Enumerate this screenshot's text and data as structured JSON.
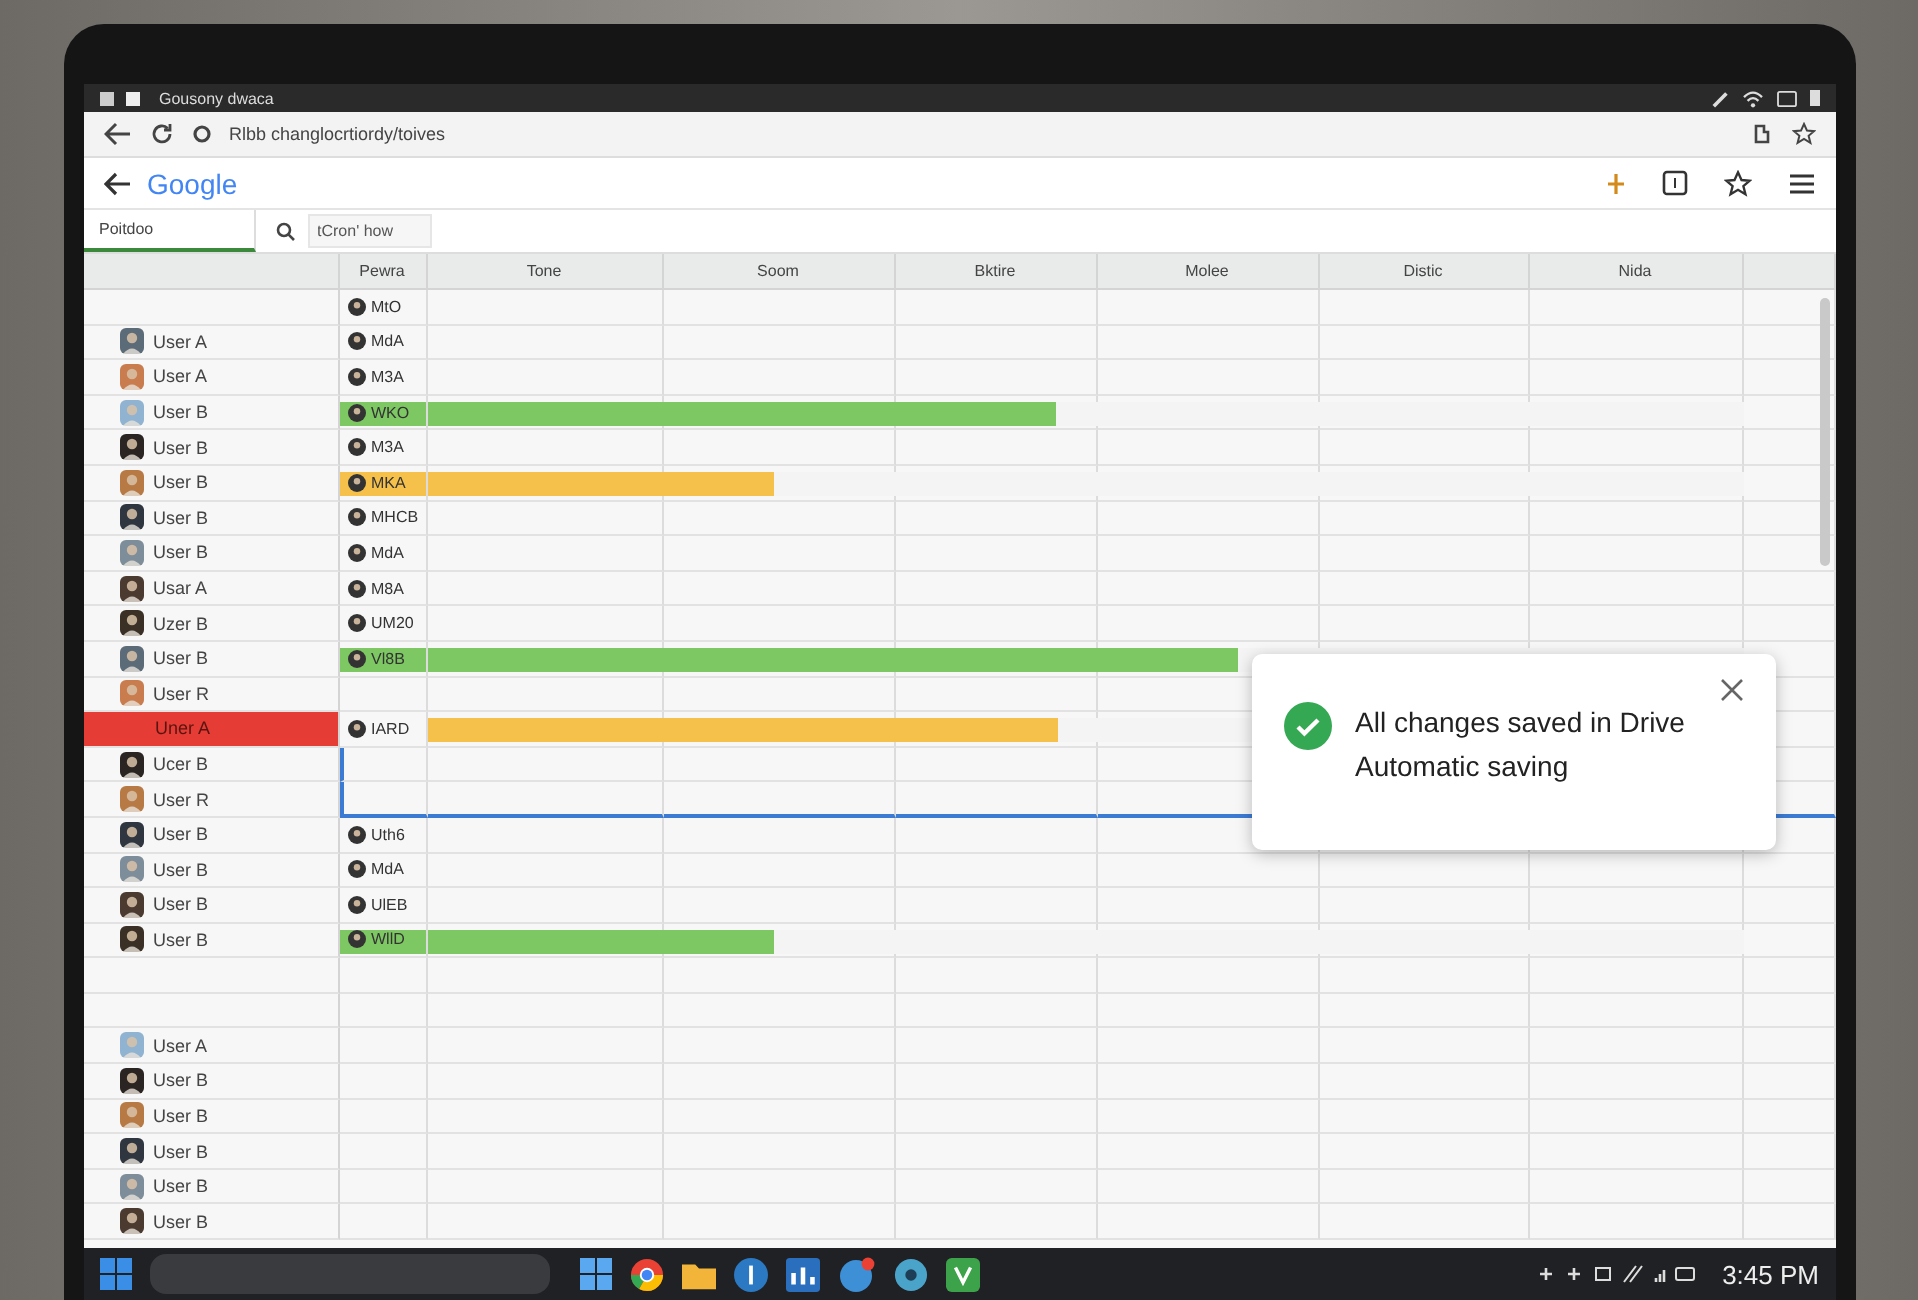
{
  "os_bar": {
    "title": "Gousony dwaca"
  },
  "address_bar": {
    "url": "Rlbb changlocrtiordy/toives"
  },
  "app_header": {
    "logo": "Google"
  },
  "toolbar": {
    "tab": {
      "label": "Poitdoo",
      "selected": true
    },
    "search": {
      "value": "tCron' how"
    }
  },
  "table": {
    "columns": [
      "Pewra",
      "Tone",
      "Soom",
      "Bktire",
      "Molee",
      "Distic",
      "Nida"
    ],
    "rows": [
      {
        "name": "",
        "chip": "MtO",
        "selected": false,
        "highlight": false
      },
      {
        "name": "User A",
        "chip": "MdA",
        "selected": false,
        "highlight": false
      },
      {
        "name": "User A",
        "chip": "M3A",
        "selected": false,
        "highlight": false
      },
      {
        "name": "User B",
        "chip": "WKO",
        "selected": false,
        "highlight": false,
        "bar": {
          "kind": "full",
          "color": "#7dc863",
          "level": 0.51
        }
      },
      {
        "name": "User B",
        "chip": "M3A",
        "selected": false,
        "highlight": false
      },
      {
        "name": "User B",
        "chip": "MKA",
        "selected": false,
        "highlight": false,
        "bar": {
          "kind": "full",
          "color": "#f5c14b",
          "level": 0.31
        }
      },
      {
        "name": "User B",
        "chip": "MHCB",
        "selected": false,
        "highlight": false
      },
      {
        "name": "User B",
        "chip": "MdA",
        "selected": false,
        "highlight": false
      },
      {
        "name": "Usar A",
        "chip": "M8A",
        "selected": false,
        "highlight": false
      },
      {
        "name": "Uzer B",
        "chip": "UM20",
        "selected": false,
        "highlight": false
      },
      {
        "name": "User B",
        "chip": "Vl8B",
        "selected": false,
        "highlight": false,
        "bar": {
          "kind": "full",
          "color": "#7dc863",
          "level": 0.64
        }
      },
      {
        "name": "User R",
        "chip": "",
        "selected": false,
        "highlight": false
      },
      {
        "name": "Uner A",
        "chip": "IARD",
        "selected": false,
        "highlight": true,
        "bar": {
          "kind": "offset",
          "color": "#f5c14b",
          "level": 0.48
        }
      },
      {
        "name": "Ucer B",
        "chip": "",
        "selected": true,
        "highlight": false
      },
      {
        "name": "User R",
        "chip": "",
        "selected": true,
        "highlight": false
      },
      {
        "name": "User B",
        "chip": "Uth6",
        "selected": false,
        "highlight": false
      },
      {
        "name": "User B",
        "chip": "MdA",
        "selected": false,
        "highlight": false
      },
      {
        "name": "User B",
        "chip": "UlEB",
        "selected": false,
        "highlight": false
      },
      {
        "name": "User B",
        "chip": "WllD",
        "selected": false,
        "highlight": false,
        "bar": {
          "kind": "full",
          "color": "#7dc863",
          "level": 0.31
        }
      },
      {
        "name": "",
        "chip": "",
        "selected": false,
        "highlight": false
      },
      {
        "name": "",
        "chip": "",
        "selected": false,
        "highlight": false
      },
      {
        "name": "User A",
        "chip": "",
        "selected": false,
        "highlight": false
      },
      {
        "name": "User B",
        "chip": "",
        "selected": false,
        "highlight": false
      },
      {
        "name": "User B",
        "chip": "",
        "selected": false,
        "highlight": false
      },
      {
        "name": "User B",
        "chip": "",
        "selected": false,
        "highlight": false
      },
      {
        "name": "User B",
        "chip": "",
        "selected": false,
        "highlight": false
      },
      {
        "name": "User B",
        "chip": "",
        "selected": false,
        "highlight": false
      }
    ]
  },
  "toast": {
    "title": "All changes saved in Drive",
    "subtitle": "Automatic saving"
  },
  "taskbar": {
    "clock": "3:45 PM"
  }
}
